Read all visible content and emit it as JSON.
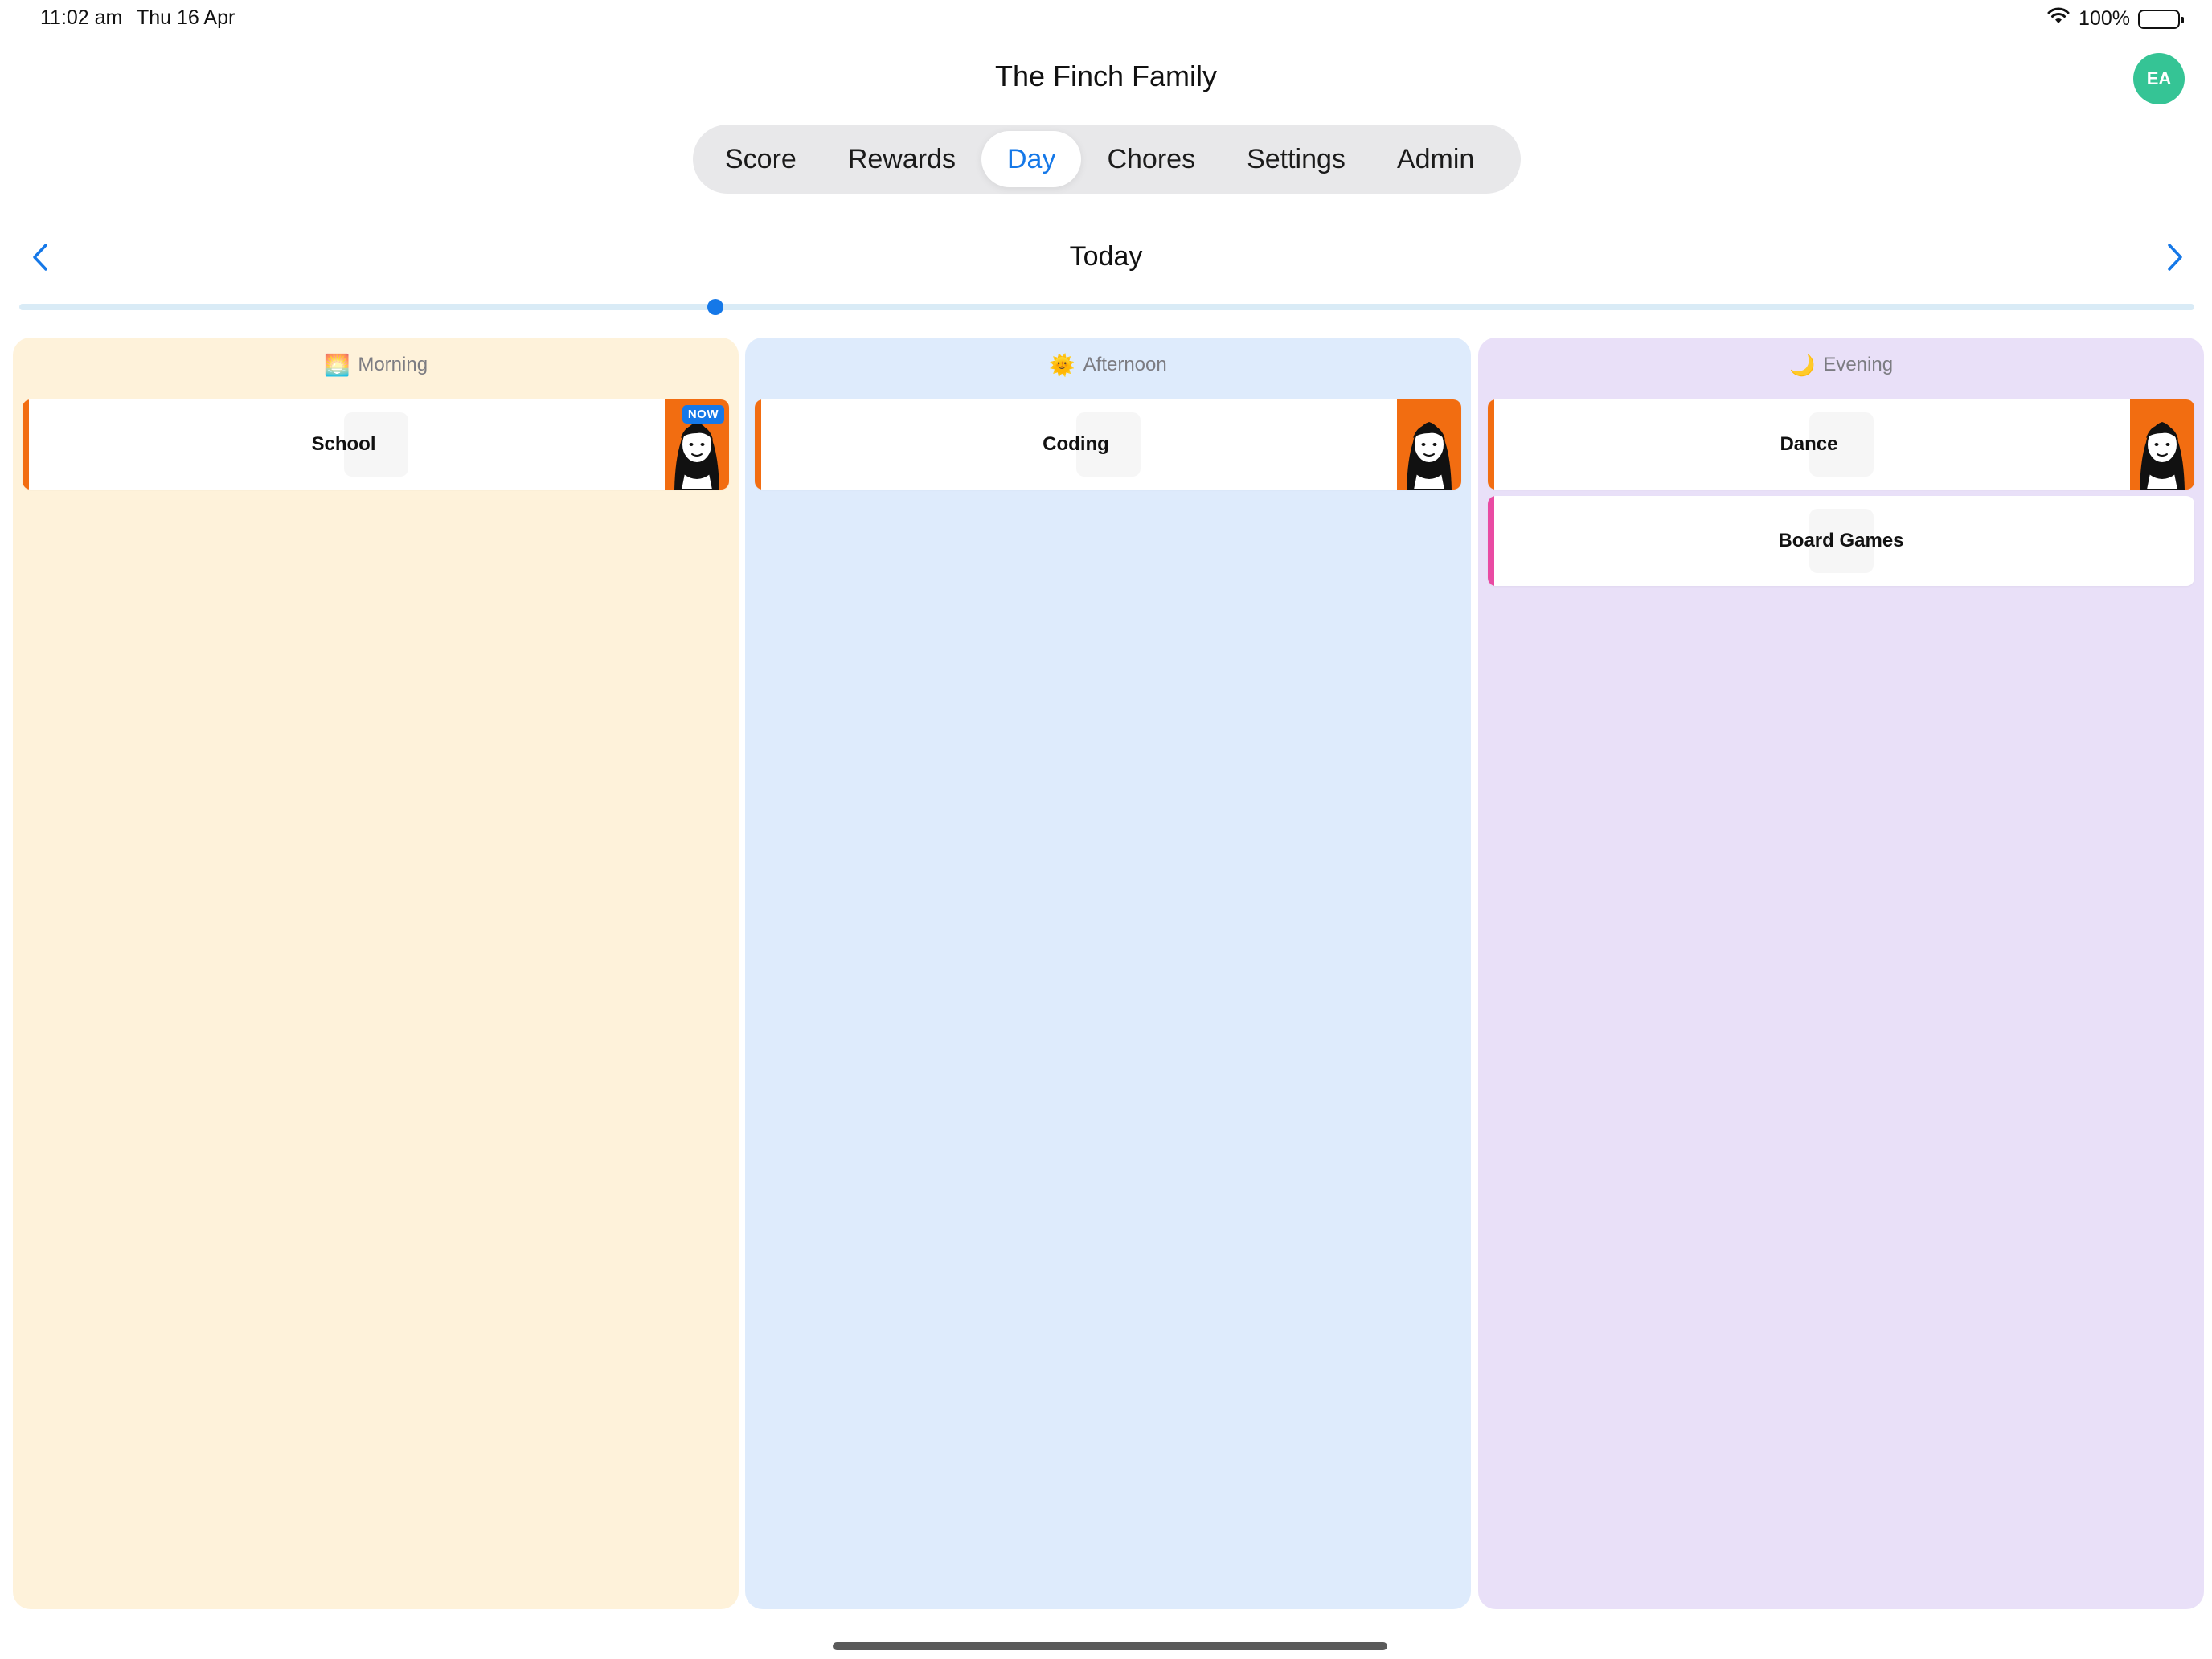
{
  "status_bar": {
    "time": "11:02 am",
    "date": "Thu 16 Apr",
    "battery": "100%",
    "icons": [
      "wifi-icon",
      "battery-icon"
    ]
  },
  "header": {
    "title": "The Finch Family",
    "avatar_initials": "EA",
    "avatar_color": "#35c495"
  },
  "tabs": [
    {
      "label": "Score",
      "active": false
    },
    {
      "label": "Rewards",
      "active": false
    },
    {
      "label": "Day",
      "active": true
    },
    {
      "label": "Chores",
      "active": false
    },
    {
      "label": "Settings",
      "active": false
    },
    {
      "label": "Admin",
      "active": false
    }
  ],
  "date_nav": {
    "label": "Today",
    "prev_icon": "chevron-left-icon",
    "next_icon": "chevron-right-icon"
  },
  "timeline": {
    "progress": 0.32,
    "accent": "#1578e8"
  },
  "columns": [
    {
      "id": "morning",
      "label": "Morning",
      "emoji": "🌅",
      "background": "#fef2da",
      "activities": [
        {
          "title": "School",
          "stripe_color": "#f26d11",
          "has_assignee": true,
          "now": true,
          "now_label": "NOW"
        }
      ]
    },
    {
      "id": "afternoon",
      "label": "Afternoon",
      "emoji": "🌞",
      "background": "#deebfc",
      "activities": [
        {
          "title": "Coding",
          "stripe_color": "#f26d11",
          "has_assignee": true,
          "now": false
        }
      ]
    },
    {
      "id": "evening",
      "label": "Evening",
      "emoji": "🌙",
      "background": "#e9e0f8",
      "activities": [
        {
          "title": "Dance",
          "stripe_color": "#f26d11",
          "has_assignee": true,
          "now": false
        },
        {
          "title": "Board Games",
          "stripe_color": "#e94aa3",
          "has_assignee": false,
          "now": false
        }
      ]
    }
  ],
  "colors": {
    "accent": "#1578e8",
    "assignee_bg": "#f26d11"
  }
}
